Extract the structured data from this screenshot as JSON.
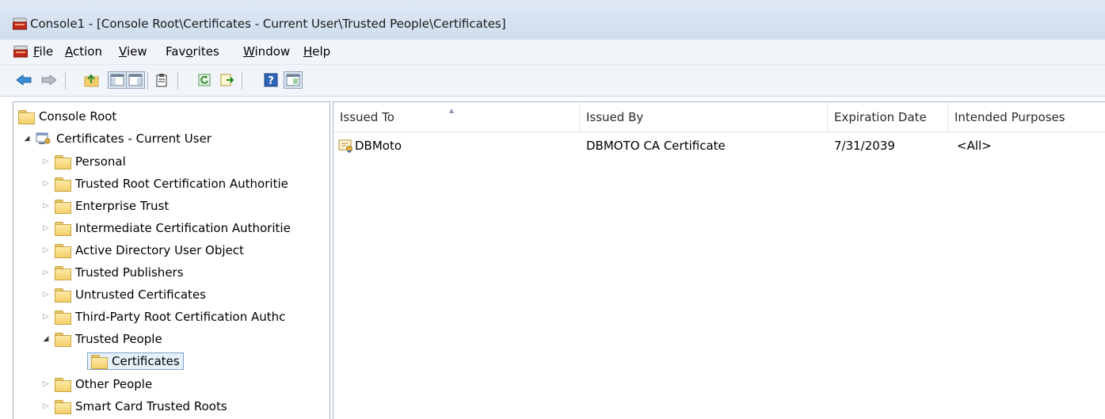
{
  "window": {
    "title": "Console1 - [Console Root\\Certificates - Current User\\Trusted People\\Certificates]"
  },
  "menu": {
    "items": [
      {
        "label": "File",
        "underline": "F",
        "rest": "ile"
      },
      {
        "label": "Action",
        "underline": "A",
        "rest": "ction"
      },
      {
        "label": "View",
        "underline": "V",
        "rest": "iew"
      },
      {
        "label": "Favorites",
        "pre": "Fav",
        "underline": "o",
        "rest": "rites"
      },
      {
        "label": "Window",
        "underline": "W",
        "rest": "indow"
      },
      {
        "label": "Help",
        "underline": "H",
        "rest": "elp"
      }
    ]
  },
  "toolbar": {
    "buttons": [
      "back-icon",
      "forward-icon",
      "up-folder-icon",
      "show-hide-tree-icon",
      "properties-icon",
      "refresh-icon",
      "export-list-icon",
      "help-icon",
      "show-hide-action-pane-icon"
    ]
  },
  "tree": {
    "root": "Console Root",
    "store": "Certificates - Current User",
    "folders": [
      {
        "label": "Personal"
      },
      {
        "label": "Trusted Root Certification Authoritie"
      },
      {
        "label": "Enterprise Trust"
      },
      {
        "label": "Intermediate Certification Authoritie"
      },
      {
        "label": "Active Directory User Object"
      },
      {
        "label": "Trusted Publishers"
      },
      {
        "label": "Untrusted Certificates"
      },
      {
        "label": "Third-Party Root Certification Authc"
      },
      {
        "label": "Trusted People"
      },
      {
        "label": "Certificates"
      },
      {
        "label": "Other People"
      },
      {
        "label": "Smart Card Trusted Roots"
      }
    ]
  },
  "list": {
    "columns": [
      "Issued To",
      "Issued By",
      "Expiration Date",
      "Intended Purposes"
    ],
    "rows": [
      {
        "issued_to": "DBMoto",
        "issued_by": "DBMOTO CA Certificate",
        "expiration": "7/31/2039",
        "purposes": "<All>"
      }
    ]
  },
  "colors": {
    "titlebar": "#cfddee",
    "selection_border": "#7da2ce",
    "folder": "#f4cf6a"
  }
}
